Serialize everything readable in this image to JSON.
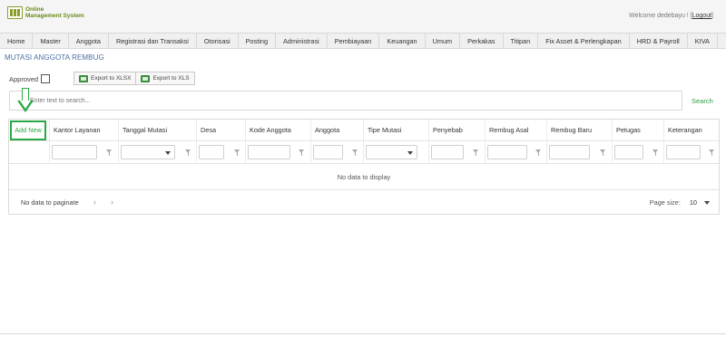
{
  "app": {
    "logo_line1": "Online",
    "logo_line2": "Management System"
  },
  "header": {
    "welcome": "Welcome dedebayu ! [",
    "logout": "Logout",
    "close_bracket": "]"
  },
  "menu": [
    "Home",
    "Master",
    "Anggota",
    "Registrasi dan Transaksi",
    "Otorisasi",
    "Posting",
    "Administrasi",
    "Pembiayaan",
    "Keuangan",
    "Umum",
    "Perkakas",
    "Titipan",
    "Fix Asset & Perlengkapan",
    "HRD & Payroll",
    "KIVA"
  ],
  "page": {
    "title": "MUTASI ANGGOTA REMBUG"
  },
  "toolbar": {
    "approved_label": "Approved",
    "export_xlsx": "Export to XLSX",
    "export_xls": "Export to XLS"
  },
  "search": {
    "placeholder": "Enter text to search...",
    "button": "Search"
  },
  "grid": {
    "add_new": "Add New",
    "columns": [
      "Kantor Layanan",
      "Tanggal Mutasi",
      "Desa",
      "Kode Anggota",
      "Anggota",
      "Tipe Mutasi",
      "Penyebab",
      "Rembug Asal",
      "Rembug Baru",
      "Petugas",
      "Keterangan"
    ],
    "empty_text": "No data to display"
  },
  "pager": {
    "status": "No data to paginate",
    "prev": "‹",
    "next": "›",
    "page_size_label": "Page size:",
    "page_size_value": "10"
  },
  "colors": {
    "accent_green": "#2aa845",
    "title_blue": "#4a6fa5"
  },
  "icons": [
    "excel-icon",
    "filter-icon",
    "chevron-down-icon",
    "arrow-down-icon"
  ]
}
